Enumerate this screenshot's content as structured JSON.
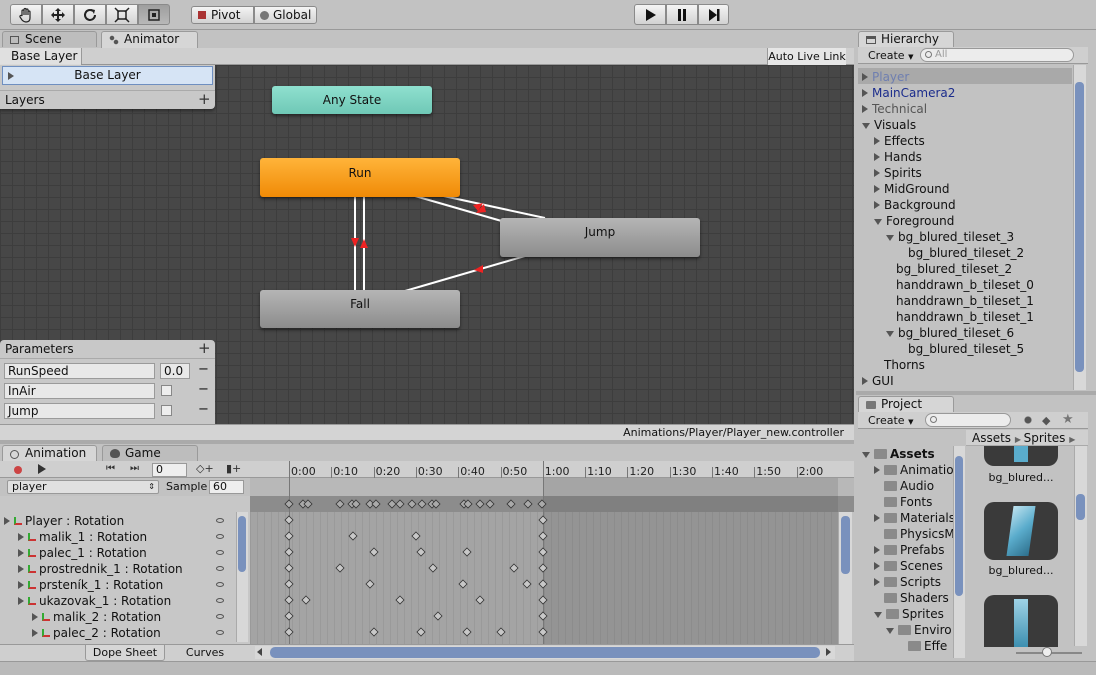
{
  "toolbar": {
    "tools": [
      "hand-icon",
      "move-icon",
      "rotate-icon",
      "scale-icon",
      "rect-icon"
    ],
    "pivot": "Pivot",
    "global": "Global",
    "play": "play-icon",
    "pause": "pause-icon",
    "step": "step-icon"
  },
  "tabs": {
    "scene": "Scene",
    "animator": "Animator"
  },
  "animator": {
    "breadcrumb": "Base Layer",
    "auto_live_link": "Auto Live Link",
    "base_layer_item": "Base Layer",
    "layers_label": "Layers",
    "parameters_label": "Parameters",
    "path": "Animations/Player/Player_new.controller",
    "states": {
      "any": "Any State",
      "run": "Run",
      "jump": "Jump",
      "fall": "Fall"
    },
    "parameters": [
      {
        "name": "RunSpeed",
        "value": "0.0"
      },
      {
        "name": "InAir",
        "value": ""
      },
      {
        "name": "Jump",
        "value": ""
      }
    ]
  },
  "hierarchy": {
    "title": "Hierarchy",
    "create": "Create",
    "search_placeholder": "All",
    "items": [
      {
        "label": "Player",
        "depth": 0,
        "fold": "right",
        "color": "#6f7fb0"
      },
      {
        "label": "MainCamera2",
        "depth": 0,
        "fold": "right",
        "color": "#1b2c8c"
      },
      {
        "label": "Technical",
        "depth": 0,
        "fold": "right",
        "color": "#555555"
      },
      {
        "label": "Visuals",
        "depth": 0,
        "fold": "down",
        "color": "#111111"
      },
      {
        "label": "Effects",
        "depth": 1,
        "fold": "right",
        "color": "#111111"
      },
      {
        "label": "Hands",
        "depth": 1,
        "fold": "right",
        "color": "#111111"
      },
      {
        "label": "Spirits",
        "depth": 1,
        "fold": "right",
        "color": "#111111"
      },
      {
        "label": "MidGround",
        "depth": 1,
        "fold": "right",
        "color": "#111111"
      },
      {
        "label": "Background",
        "depth": 1,
        "fold": "right",
        "color": "#111111"
      },
      {
        "label": "Foreground",
        "depth": 1,
        "fold": "down",
        "color": "#111111"
      },
      {
        "label": "bg_blured_tileset_3",
        "depth": 2,
        "fold": "down",
        "color": "#111111"
      },
      {
        "label": "bg_blured_tileset_2",
        "depth": 3,
        "fold": "",
        "color": "#111111"
      },
      {
        "label": "bg_blured_tileset_2",
        "depth": 2,
        "fold": "",
        "color": "#111111"
      },
      {
        "label": "handdrawn_b_tileset_0",
        "depth": 2,
        "fold": "",
        "color": "#111111"
      },
      {
        "label": "handdrawn_b_tileset_1",
        "depth": 2,
        "fold": "",
        "color": "#111111"
      },
      {
        "label": "handdrawn_b_tileset_1",
        "depth": 2,
        "fold": "",
        "color": "#111111"
      },
      {
        "label": "bg_blured_tileset_6",
        "depth": 2,
        "fold": "down",
        "color": "#111111"
      },
      {
        "label": "bg_blured_tileset_5",
        "depth": 3,
        "fold": "",
        "color": "#111111"
      },
      {
        "label": "Thorns",
        "depth": 1,
        "fold": "",
        "color": "#111111"
      },
      {
        "label": "GUI",
        "depth": 0,
        "fold": "right",
        "color": "#111111"
      }
    ]
  },
  "project": {
    "title": "Project",
    "create": "Create",
    "breadcrumb": [
      "Assets",
      "Sprites"
    ],
    "folders": [
      {
        "label": "Assets",
        "depth": 0,
        "fold": "down",
        "bold": true
      },
      {
        "label": "Animatio",
        "depth": 1,
        "fold": "right"
      },
      {
        "label": "Audio",
        "depth": 1,
        "fold": ""
      },
      {
        "label": "Fonts",
        "depth": 1,
        "fold": ""
      },
      {
        "label": "Materials",
        "depth": 1,
        "fold": "right"
      },
      {
        "label": "PhysicsM",
        "depth": 1,
        "fold": ""
      },
      {
        "label": "Prefabs",
        "depth": 1,
        "fold": "right"
      },
      {
        "label": "Scenes",
        "depth": 1,
        "fold": "right"
      },
      {
        "label": "Scripts",
        "depth": 1,
        "fold": "right"
      },
      {
        "label": "Shaders",
        "depth": 1,
        "fold": ""
      },
      {
        "label": "Sprites",
        "depth": 1,
        "fold": "down"
      },
      {
        "label": "Enviro",
        "depth": 2,
        "fold": "down"
      },
      {
        "label": "Effe",
        "depth": 3,
        "fold": ""
      }
    ],
    "assets": [
      {
        "label": "bg_blured..."
      },
      {
        "label": "bg_blured..."
      }
    ]
  },
  "animation": {
    "tabs": {
      "animation": "Animation",
      "game": "Game"
    },
    "frame": "0",
    "clip": "player",
    "sample_label": "Sample",
    "sample": "60",
    "ticks": [
      "0:00",
      "0:10",
      "0:20",
      "0:30",
      "0:40",
      "0:50",
      "1:00",
      "1:10",
      "1:20",
      "1:30",
      "1:40",
      "1:50",
      "2:00"
    ],
    "tracks": [
      {
        "label": "Player : Rotation",
        "depth": 0
      },
      {
        "label": "malik_1 : Rotation",
        "depth": 1
      },
      {
        "label": "palec_1 : Rotation",
        "depth": 1
      },
      {
        "label": "prostrednik_1 : Rotation",
        "depth": 1
      },
      {
        "label": "prsteník_1 : Rotation",
        "depth": 1
      },
      {
        "label": "ukazovak_1 : Rotation",
        "depth": 1
      },
      {
        "label": "malik_2 : Rotation",
        "depth": 2
      },
      {
        "label": "palec_2 : Rotation",
        "depth": 2
      }
    ],
    "bottom_tabs": {
      "dopesheet": "Dope Sheet",
      "curves": "Curves"
    }
  }
}
